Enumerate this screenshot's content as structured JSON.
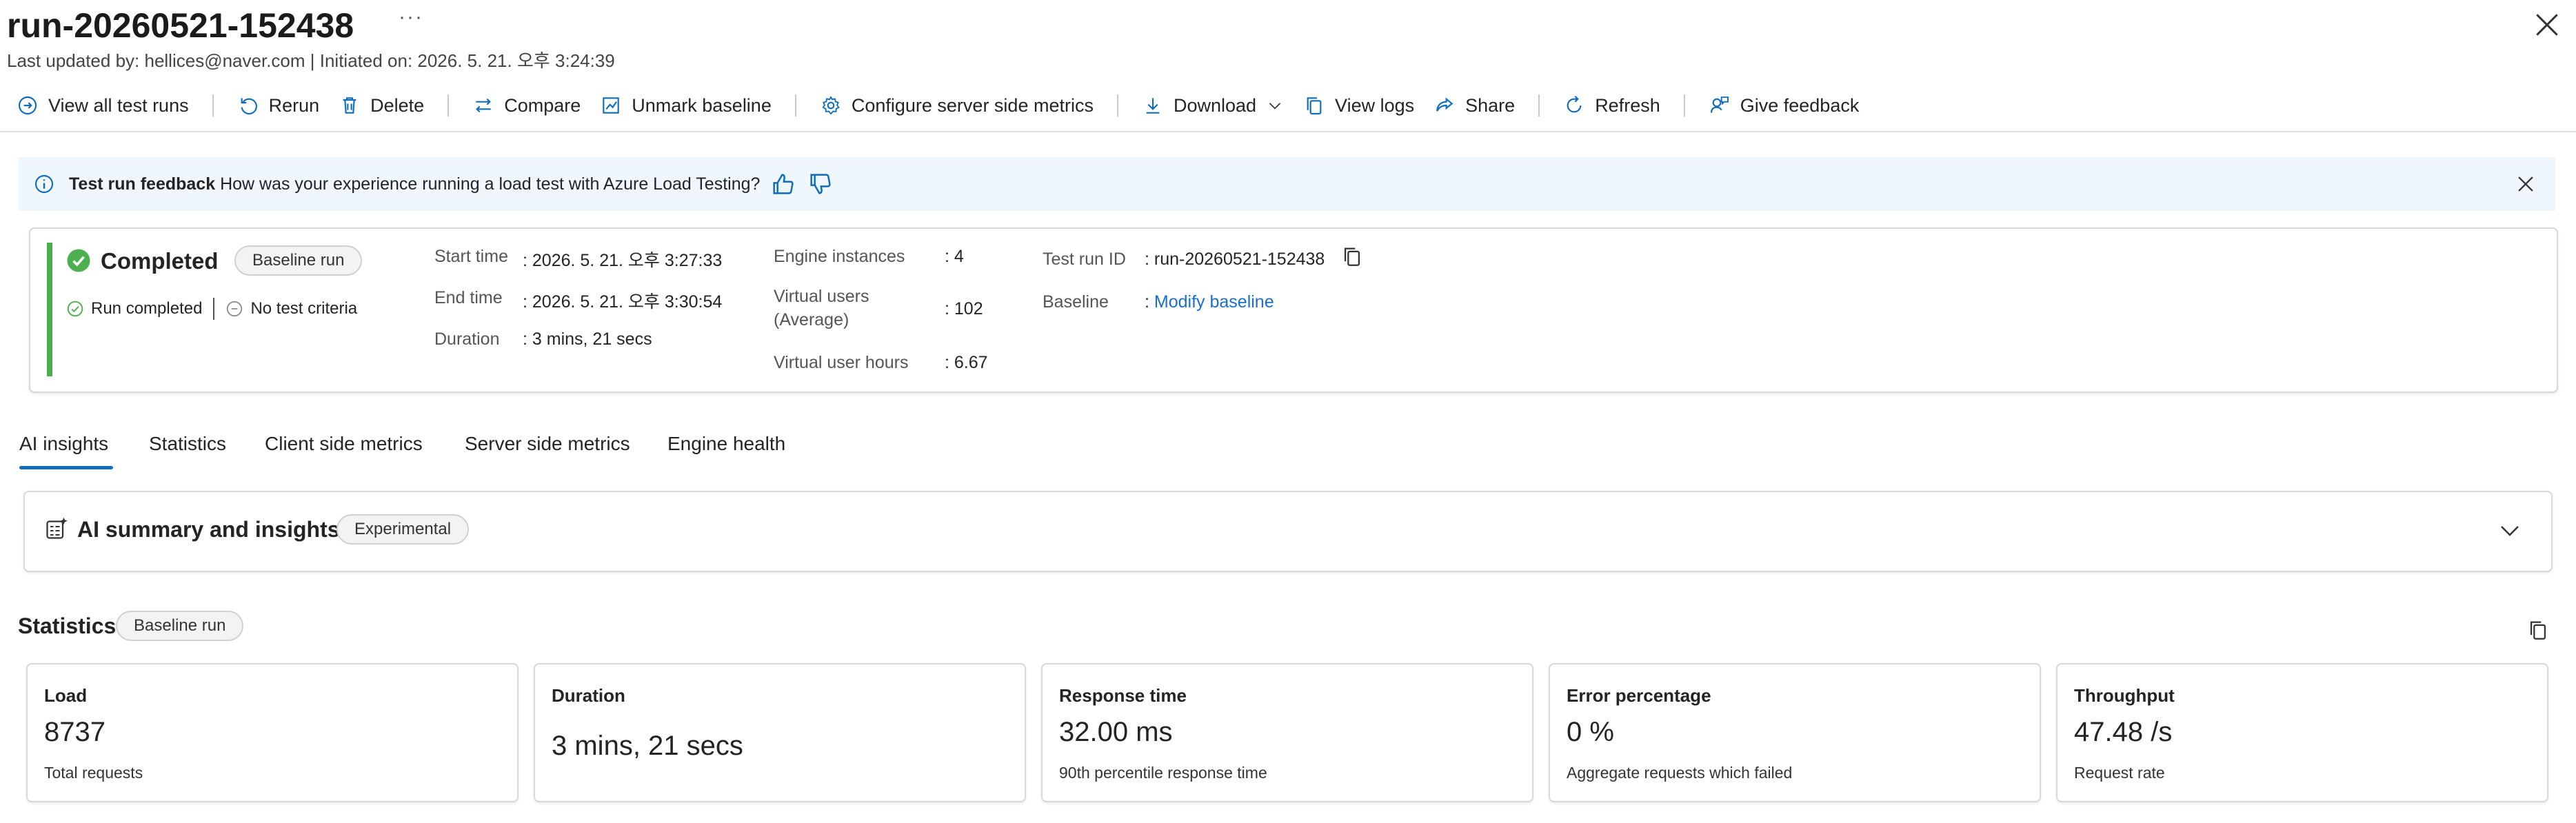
{
  "header": {
    "title": "run-20260521-152438",
    "more": "···",
    "subtitle": "Last updated by: hellices@naver.com | Initiated on: 2026. 5. 21. 오후 3:24:39"
  },
  "toolbar": {
    "view_all": "View all test runs",
    "rerun": "Rerun",
    "delete": "Delete",
    "compare": "Compare",
    "unmark_baseline": "Unmark baseline",
    "configure_metrics": "Configure server side metrics",
    "download": "Download",
    "view_logs": "View logs",
    "share": "Share",
    "refresh": "Refresh",
    "give_feedback": "Give feedback"
  },
  "banner": {
    "title": "Test run feedback",
    "question": "How was your experience running a load test with Azure Load Testing?"
  },
  "status": {
    "state": "Completed",
    "badge": "Baseline run",
    "run_completed": "Run completed",
    "criteria": "No test criteria",
    "start_label": "Start time",
    "start_value": ": 2026. 5. 21. 오후 3:27:33",
    "end_label": "End time",
    "end_value": ": 2026. 5. 21. 오후 3:30:54",
    "duration_label": "Duration",
    "duration_value": ": 3 mins, 21 secs",
    "engines_label": "Engine instances",
    "engines_value": ": 4",
    "vusers_label_1": "Virtual users",
    "vusers_label_2": "(Average)",
    "vusers_value": ": 102",
    "vuhours_label": "Virtual user hours",
    "vuhours_value": ": 6.67",
    "runid_label": "Test run ID",
    "runid_value": ": run-20260521-152438",
    "baseline_label": "Baseline",
    "baseline_colon": ": ",
    "baseline_link": "Modify baseline"
  },
  "tabs": [
    "AI insights",
    "Statistics",
    "Client side metrics",
    "Server side metrics",
    "Engine health"
  ],
  "ai": {
    "title": "AI summary and insights",
    "badge": "Experimental"
  },
  "stats": {
    "title": "Statistics",
    "badge": "Baseline run",
    "metrics": [
      {
        "label": "Load",
        "value": "8737",
        "desc": "Total requests"
      },
      {
        "label": "Duration",
        "value": "3 mins, 21 secs",
        "desc": ""
      },
      {
        "label": "Response time",
        "value": "32.00 ms",
        "desc": "90th percentile response time"
      },
      {
        "label": "Error percentage",
        "value": "0 %",
        "desc": "Aggregate requests which failed"
      },
      {
        "label": "Throughput",
        "value": "47.48 /s",
        "desc": "Request rate"
      }
    ]
  },
  "colors": {
    "accent": "#0f6cbd",
    "success": "#4caf50",
    "banner_bg": "#eff6fc",
    "link": "#1a6fc9"
  }
}
